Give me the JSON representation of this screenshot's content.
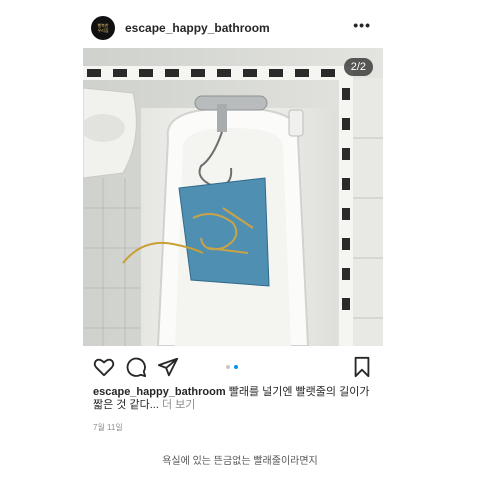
{
  "post": {
    "username": "escape_happy_bathroom",
    "avatar_text": [
      "행복한",
      "우리집"
    ],
    "more_icon": "more-horizontal-icon",
    "media": {
      "counter": "2/2"
    },
    "actions": {
      "icons": [
        "heart-icon",
        "comment-icon",
        "share-icon",
        "bookmark-icon"
      ],
      "carousel_dots": 2,
      "active_dot": 1
    },
    "caption": {
      "username": "escape_happy_bathroom",
      "text": "빨래를 널기엔 빨랫줄의 길이가 짧은 것 같다...",
      "more": "더 보기"
    },
    "date": "7월 11일",
    "colors": {
      "accent": "#0095f6",
      "text": "#262626",
      "muted": "#8e8e8e"
    }
  },
  "footer": {
    "text": "욕실에 있는 뜬금없는 빨래줄이라면지"
  }
}
